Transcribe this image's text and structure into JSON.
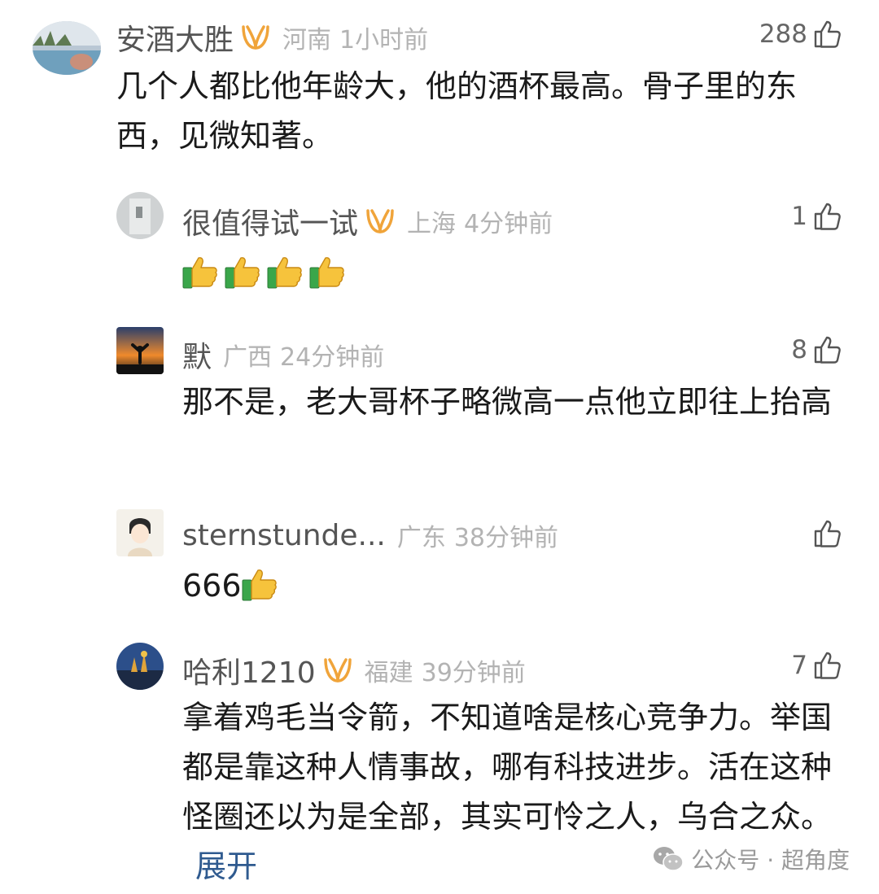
{
  "comments": [
    {
      "username": "安酒大胜",
      "location": "河南",
      "time": "1小时前",
      "likes": "288",
      "body": "几个人都比他年龄大，他的酒杯最高。骨子里的东西，见微知著。",
      "vip": true
    },
    {
      "username": "很值得试一试",
      "location": "上海",
      "time": "4分钟前",
      "likes": "1",
      "body_emoji_count": 4,
      "vip": true
    },
    {
      "username": "默",
      "location": "广西",
      "time": "24分钟前",
      "likes": "8",
      "body": "那不是，老大哥杯子略微高一点他立即往上抬高",
      "vip": false
    },
    {
      "username": "sternstunde...",
      "location": "广东",
      "time": "38分钟前",
      "likes": "",
      "body": "666",
      "body_emoji_count": 1,
      "vip": false
    },
    {
      "username": "哈利1210",
      "location": "福建",
      "time": "39分钟前",
      "likes": "7",
      "body": "拿着鸡毛当令箭，不知道啥是核心竞争力。举国都是靠这种人情事故，哪有科技进步。活在这种怪圈还以为是全部，其实可怜之人，乌合之众。",
      "expand_label": "展开",
      "vip": true
    }
  ],
  "watermark": {
    "text": "公众号 · 超角度",
    "icon": "wechat-icon"
  },
  "icons": {
    "like": "thumbs-up-outline-icon",
    "vip": "vip-badge-icon",
    "emoji": "thumbs-up-emoji-icon"
  },
  "colors": {
    "vip_badge": "#f0a43a",
    "expand_link": "#2f5a8f",
    "meta_gray": "#b3b3b3"
  }
}
